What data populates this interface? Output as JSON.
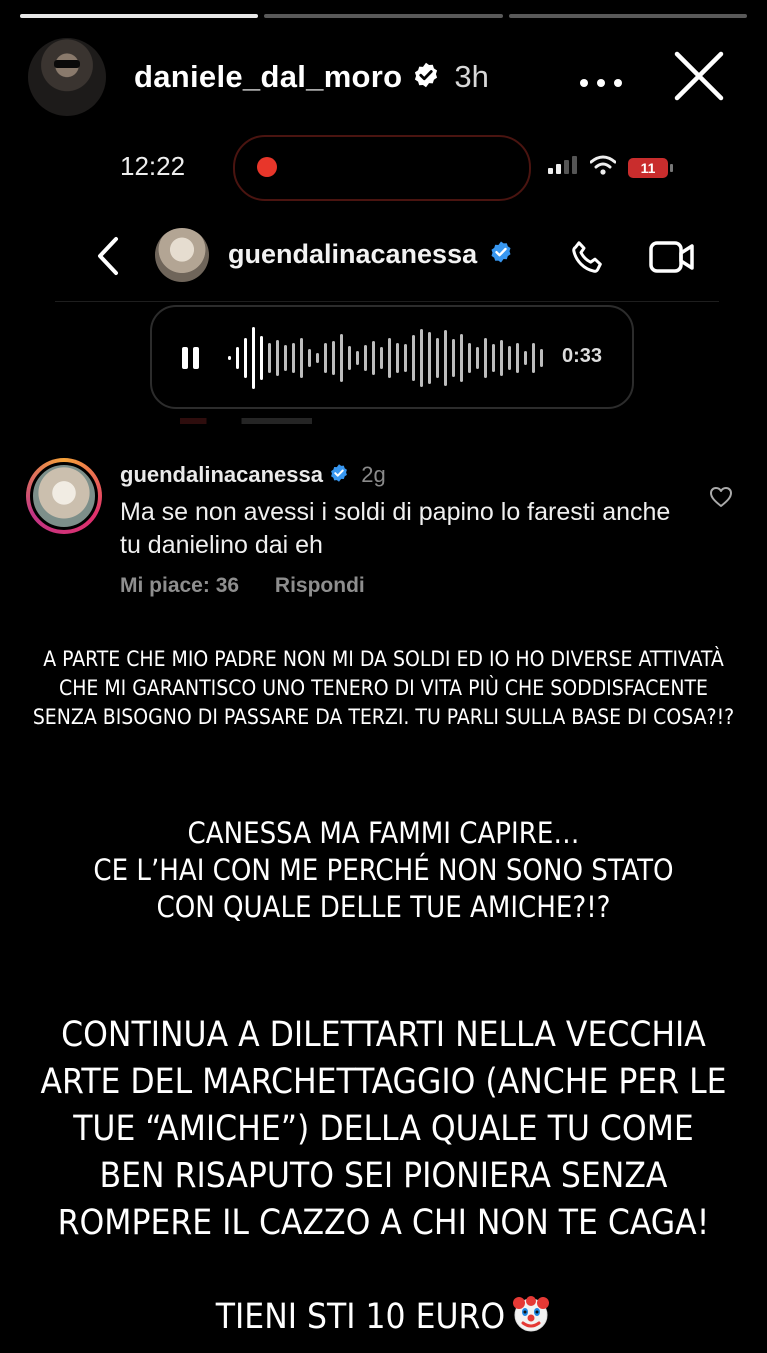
{
  "story": {
    "progress": [
      1.0,
      0.0,
      0.0
    ],
    "username": "daniele_dal_moro",
    "time_ago": "3h",
    "more_icon": "more-horizontal-icon",
    "close_icon": "close-icon"
  },
  "phone": {
    "time": "12:22",
    "battery": "11",
    "colors": {
      "record": "#e8362a",
      "battery": "#c92d2d"
    }
  },
  "chat": {
    "name": "guendalinacanessa",
    "voice_duration": "0:33"
  },
  "comment": {
    "username": "guendalinacanessa",
    "time_ago": "2g",
    "text": "Ma se non avessi i soldi di papino lo faresti anche tu danielino dai eh",
    "likes": "Mi piace: 36",
    "reply": "Rispondi"
  },
  "overlays": {
    "text1": "A parte che mio padre non mi da soldi ed io ho diverse attivatà che mi garantisco uno tenero di vita più che soddisfacente senza bisogno di passare da terzi. Tu parli sulla base di cosa?!?",
    "text2": "Canessa ma fammi capire…\nCe l’hai con me perché non  sono stato\ncon quale delle tue amiche?!?",
    "text3": "Continua a dilettarti nella vecchia arte del marchettaggio (anche per le tue “amiche”) della quale tu come ben risaputo sei pioniera senza rompere il cazzo a chi non te caga!",
    "text3_last": "Tieni sti 10 euro"
  }
}
